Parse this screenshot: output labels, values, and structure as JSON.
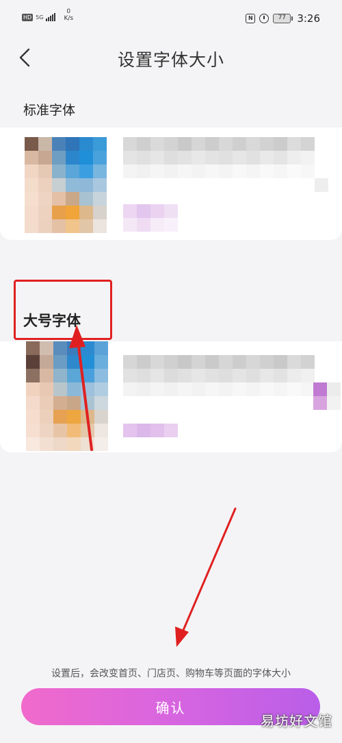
{
  "status_bar": {
    "hd": "HD",
    "network": "5G",
    "speed_value": "0",
    "speed_unit": "K/s",
    "nfc": "N",
    "battery": "77",
    "time": "3:26"
  },
  "header": {
    "title": "设置字体大小",
    "back_icon": "chevron-left-icon"
  },
  "options": [
    {
      "label": "标准字体"
    },
    {
      "label": "大号字体"
    }
  ],
  "footer": {
    "note": "设置后，会改变首页、门店页、购物车等页面的字体大小",
    "confirm_label": "确认"
  },
  "watermark": "易坊好文馆",
  "colors": {
    "accent_start": "#f06acb",
    "accent_end": "#b95ee8",
    "annotation": "#e02020"
  }
}
